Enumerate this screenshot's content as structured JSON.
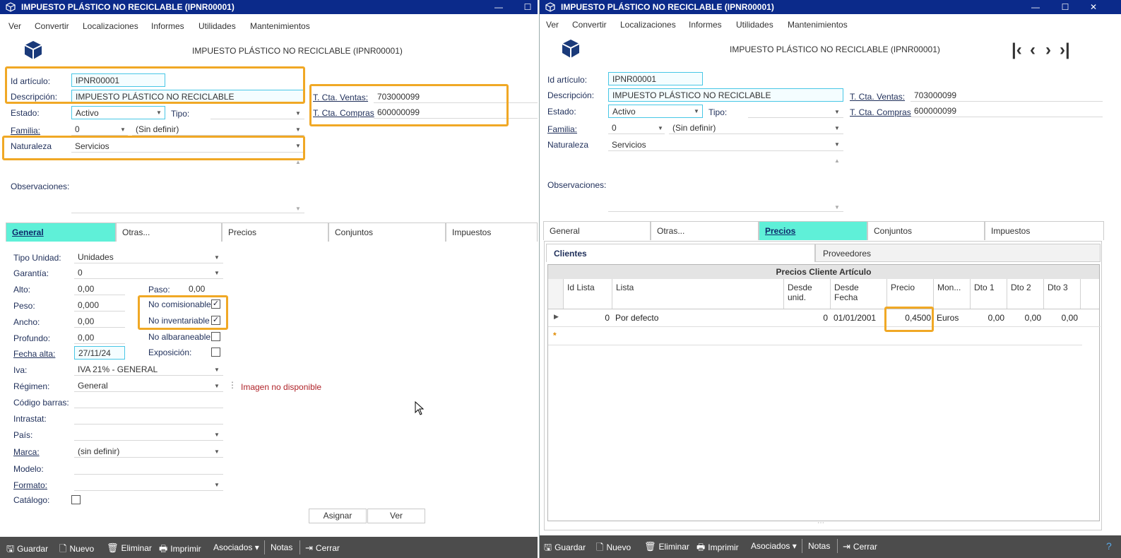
{
  "left": {
    "window_title": "IMPUESTO PLÁSTICO NO RECICLABLE (IPNR00001)",
    "menu": [
      "Ver",
      "Convertir",
      "Localizaciones",
      "Informes",
      "Utilidades",
      "Mantenimientos"
    ],
    "header_title": "IMPUESTO PLÁSTICO NO RECICLABLE (IPNR00001)",
    "id_label": "Id artículo:",
    "id_value": "IPNR00001",
    "desc_label": "Descripción:",
    "desc_value": "IMPUESTO PLÁSTICO NO RECICLABLE",
    "estado_label": "Estado:",
    "estado_value": "Activo",
    "tipo_label": "Tipo:",
    "tipo_value": "",
    "familia_label": "Familia:",
    "familia_code": "0",
    "familia_name": "(Sin definir)",
    "naturaleza_label": "Naturaleza",
    "naturaleza_value": "Servicios",
    "obs_label": "Observaciones:",
    "cta_ventas_label": "T. Cta. Ventas:",
    "cta_ventas_value": "703000099",
    "cta_compras_label": "T. Cta. Compras",
    "cta_compras_value": "600000099",
    "tabs": [
      "General",
      "Otras...",
      "Precios",
      "Conjuntos",
      "Impuestos"
    ],
    "general": {
      "tipo_unidad_label": "Tipo Unidad:",
      "tipo_unidad_value": "Unidades",
      "garantia_label": "Garantía:",
      "garantia_value": "0",
      "alto_label": "Alto:",
      "alto_value": "0,00",
      "paso_label": "Paso:",
      "paso_value": "0,00",
      "peso_label": "Peso:",
      "peso_value": "0,000",
      "ancho_label": "Ancho:",
      "ancho_value": "0,00",
      "profundo_label": "Profundo:",
      "profundo_value": "0,00",
      "fecha_alta_label": "Fecha alta:",
      "fecha_alta_value": "27/11/24",
      "iva_label": "Iva:",
      "iva_value": "IVA 21% - GENERAL",
      "regimen_label": "Régimen:",
      "regimen_value": "General",
      "codigo_barras_label": "Código barras:",
      "intrastat_label": "Intrastat:",
      "pais_label": "País:",
      "marca_label": "Marca:",
      "marca_value": "(sin definir)",
      "modelo_label": "Modelo:",
      "formato_label": "Formato:",
      "catalogo_label": "Catálogo:",
      "no_comisionable_label": "No comisionable",
      "no_inventariable_label": "No inventariable",
      "no_albaraneable_label": "No albaraneable:",
      "exposicion_label": "Exposición:",
      "imagen_no_disponible": "Imagen no disponible",
      "asignar_label": "Asignar",
      "ver_label": "Ver"
    }
  },
  "right": {
    "window_title": "IMPUESTO PLÁSTICO NO RECICLABLE (IPNR00001)",
    "menu": [
      "Ver",
      "Convertir",
      "Localizaciones",
      "Informes",
      "Utilidades",
      "Mantenimientos"
    ],
    "header_title": "IMPUESTO PLÁSTICO NO RECICLABLE (IPNR00001)",
    "id_label": "Id artículo:",
    "id_value": "IPNR00001",
    "desc_label": "Descripción:",
    "desc_value": "IMPUESTO PLÁSTICO NO RECICLABLE",
    "estado_label": "Estado:",
    "estado_value": "Activo",
    "tipo_label": "Tipo:",
    "tipo_value": "",
    "familia_label": "Familia:",
    "familia_code": "0",
    "familia_name": "(Sin definir)",
    "naturaleza_label": "Naturaleza",
    "naturaleza_value": "Servicios",
    "obs_label": "Observaciones:",
    "cta_ventas_label": "T. Cta. Ventas:",
    "cta_ventas_value": "703000099",
    "cta_compras_label": "T. Cta. Compras",
    "cta_compras_value": "600000099",
    "tabs": [
      "General",
      "Otras...",
      "Precios",
      "Conjuntos",
      "Impuestos"
    ],
    "subtabs": [
      "Clientes",
      "Proveedores"
    ],
    "grid": {
      "caption": "Precios Cliente Artículo",
      "headers": [
        "Id Lista",
        "Lista",
        "Desde unid.",
        "Desde Fecha",
        "Precio",
        "Mon...",
        "Dto 1",
        "Dto 2",
        "Dto 3"
      ],
      "row": {
        "id_lista": "0",
        "lista": "Por defecto",
        "desde_unid": "0",
        "desde_fecha": "01/01/2001",
        "precio": "0,4500",
        "moneda": "Euros",
        "dto1": "0,00",
        "dto2": "0,00",
        "dto3": "0,00"
      },
      "new_row_marker": "*"
    }
  },
  "footer": {
    "guardar": "Guardar",
    "nuevo": "Nuevo",
    "eliminar": "Eliminar",
    "imprimir": "Imprimir",
    "asociados": "Asociados",
    "notas": "Notas",
    "cerrar": "Cerrar"
  },
  "colors": {
    "titlebar": "#0b2a8a",
    "highlight": "#f0a825",
    "active_tab": "#5ff0d8",
    "input_border": "#48c7e6",
    "footer": "#4c4c4c"
  }
}
